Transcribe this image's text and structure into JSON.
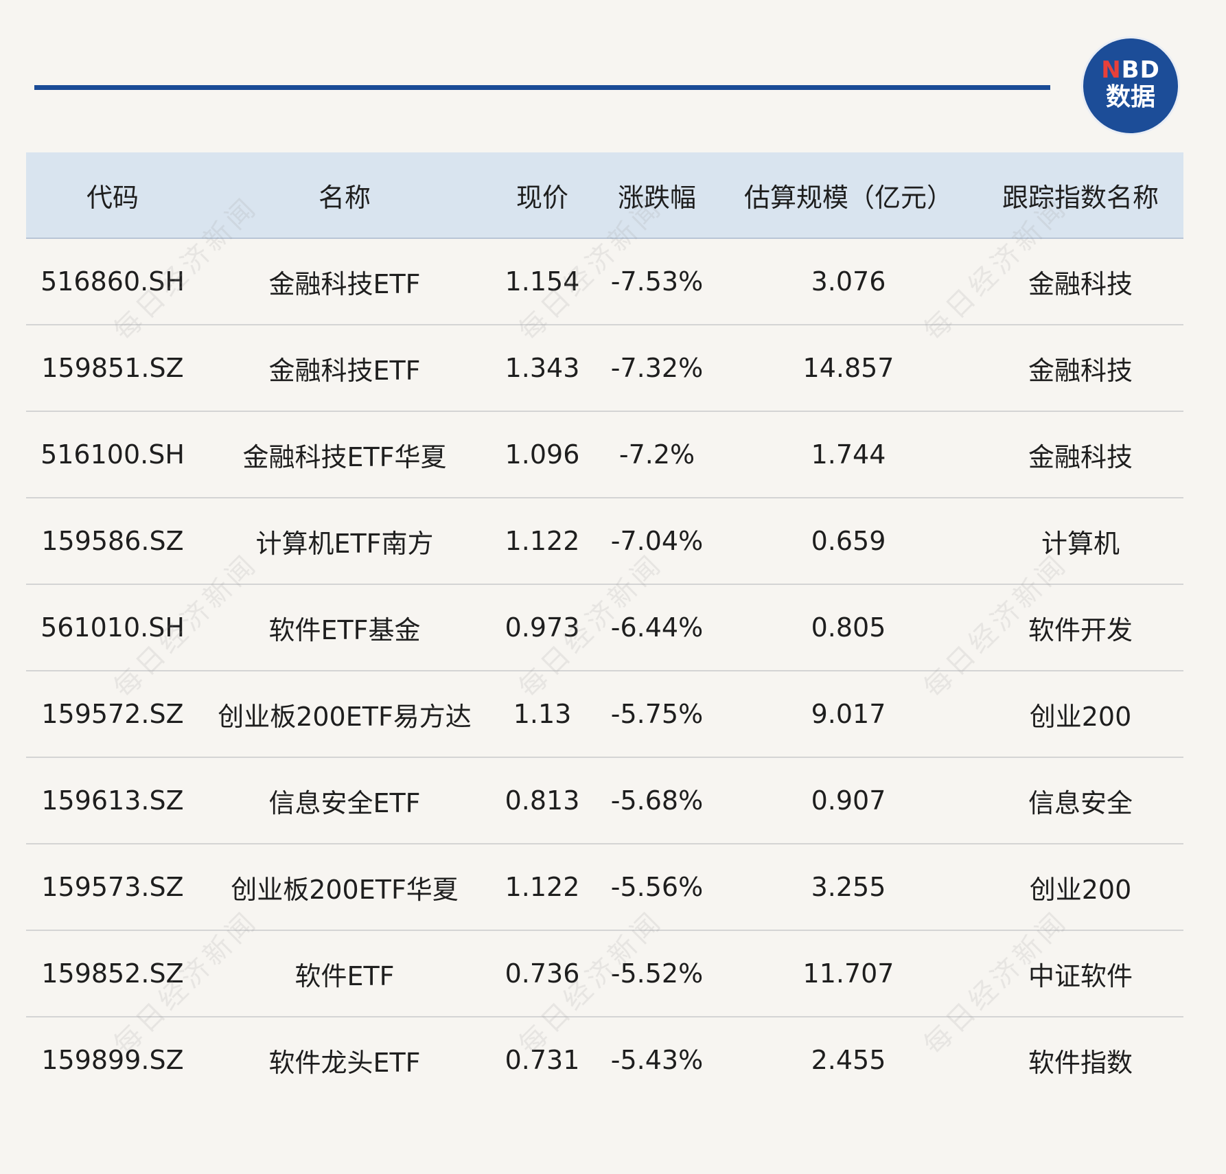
{
  "logo": {
    "line1_accent": "N",
    "line1_rest": "BD",
    "line2": "数据"
  },
  "watermark_text": "每日经济新闻",
  "table": {
    "headers": [
      "代码",
      "名称",
      "现价",
      "涨跌幅",
      "估算规模（亿元）",
      "跟踪指数名称"
    ],
    "rows": [
      [
        "516860.SH",
        "金融科技ETF",
        "1.154",
        "-7.53%",
        "3.076",
        "金融科技"
      ],
      [
        "159851.SZ",
        "金融科技ETF",
        "1.343",
        "-7.32%",
        "14.857",
        "金融科技"
      ],
      [
        "516100.SH",
        "金融科技ETF华夏",
        "1.096",
        "-7.2%",
        "1.744",
        "金融科技"
      ],
      [
        "159586.SZ",
        "计算机ETF南方",
        "1.122",
        "-7.04%",
        "0.659",
        "计算机"
      ],
      [
        "561010.SH",
        "软件ETF基金",
        "0.973",
        "-6.44%",
        "0.805",
        "软件开发"
      ],
      [
        "159572.SZ",
        "创业板200ETF易方达",
        "1.13",
        "-5.75%",
        "9.017",
        "创业200"
      ],
      [
        "159613.SZ",
        "信息安全ETF",
        "0.813",
        "-5.68%",
        "0.907",
        "信息安全"
      ],
      [
        "159573.SZ",
        "创业板200ETF华夏",
        "1.122",
        "-5.56%",
        "3.255",
        "创业200"
      ],
      [
        "159852.SZ",
        "软件ETF",
        "0.736",
        "-5.52%",
        "11.707",
        "中证软件"
      ],
      [
        "159899.SZ",
        "软件龙头ETF",
        "0.731",
        "-5.43%",
        "2.455",
        "软件指数"
      ]
    ]
  },
  "colors": {
    "background": "#f7f5f1",
    "header_bg": "#d9e4ef",
    "rule": "#1a4b96",
    "logo_bg": "#1c4d98",
    "logo_accent": "#e8403a"
  }
}
